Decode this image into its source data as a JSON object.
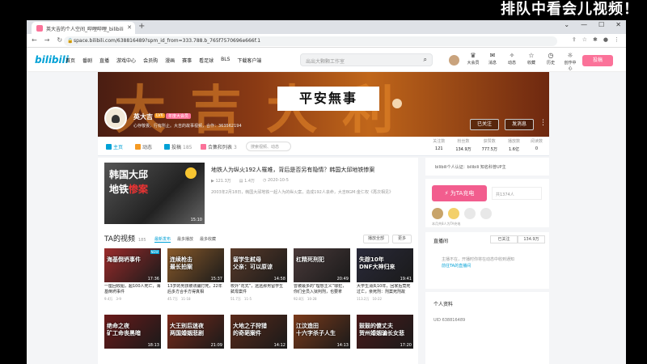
{
  "overlay_text": "排队中看会儿视频！",
  "browser": {
    "tab_title": "英大吉的个人空间_哔哩哔哩_bilibili",
    "url": "space.bilibili.com/638816489?spm_id_from=333.788.b_765f7570696e666f.1"
  },
  "topnav": {
    "logo": "bilibili",
    "links": [
      "首页",
      "番剧",
      "直播",
      "游戏中心",
      "会员购",
      "漫画",
      "赛事",
      "看足球",
      "BLS",
      "下载客户端"
    ],
    "search_placeholder": "出出大颗颗工作室",
    "right_items": [
      "大会员",
      "消息",
      "动态",
      "收藏",
      "历史",
      "创作中心"
    ],
    "upload_label": "投稿"
  },
  "profile": {
    "banner_big_text": "大吉大利",
    "banner_slogan": "平安無事",
    "name": "英大吉",
    "level": "LV6",
    "vip": "年度大会员",
    "sign": "心存敬畏，行有所止。大吉的故事视频，合作：363562194",
    "followed_label": "已关注",
    "message_label": "发消息"
  },
  "subnav": {
    "items": [
      {
        "label": "主页",
        "count": ""
      },
      {
        "label": "动态",
        "count": ""
      },
      {
        "label": "投稿",
        "count": "185"
      },
      {
        "label": "合集和列表",
        "count": "3"
      }
    ],
    "search_placeholder": "搜索视频、动态",
    "stats": [
      {
        "label": "关注数",
        "value": "121"
      },
      {
        "label": "粉丝数",
        "value": "134.9万"
      },
      {
        "label": "获赞数",
        "value": "777.5万"
      },
      {
        "label": "播放数",
        "value": "1.6亿"
      },
      {
        "label": "阅读数",
        "value": "0"
      }
    ]
  },
  "featured": {
    "thumb_line1": "韩国大邱",
    "thumb_line2_a": "地铁",
    "thumb_line2_b": "惨案",
    "duration": "15:10",
    "title": "地铁人为纵火192人罹难，背后是否另有隐情？韩国大邱地铁惨案",
    "views": "121.3万",
    "danmaku": "1.4万",
    "date": "2020-10-5",
    "desc": "2003年2月18日，韩国大邱地铁一起人为的纵火案，造成192人丧命，大吉BGM:金仁权《再次相见》"
  },
  "videos_section": {
    "title": "TA的视频",
    "count": "185",
    "sort": [
      "最新发布",
      "最多播放",
      "最多收藏"
    ],
    "play_all": "播放全部",
    "more": "更多"
  },
  "videos": [
    {
      "cap1": "海基倒坍事件",
      "cap2": "",
      "dur": "17:36",
      "title": "一座回收船，超100人死亡，海基倒坍事件",
      "views": "9.4万",
      "date": "3-9",
      "color": "#9a2b2b",
      "badge": "NEW"
    },
    {
      "cap1": "连续枪击",
      "cap2": "最长拍案",
      "dur": "15:37",
      "title": "13岁的男孩被诱骗打死，22年后多方合手方得真相",
      "views": "45.7万",
      "date": "11-18",
      "color": "#8a5a2a",
      "badge": ""
    },
    {
      "cap1": "留学生弒母",
      "cap2": "父亲：可以原谅",
      "dur": "14:58",
      "title": "校外“花式”，远远那男留学生弑母案件",
      "views": "51.7万",
      "date": "11-5",
      "color": "#5a3b2a",
      "badge": ""
    },
    {
      "cap1": "杠精死刑犯",
      "cap2": "",
      "dur": "20:49",
      "title": "曾被最多的“理想主义”罪犯，你们全员入狱判刑，也要拿",
      "views": "92.8万",
      "date": "10-28",
      "color": "#4a3a3a",
      "badge": ""
    },
    {
      "cap1": "失踪10年",
      "cap2": "DNF大神归来",
      "dur": "19:41",
      "title": "大学生消失10年，回家后竟死过亡，亲死刑：刑案死刑故",
      "views": "113.2万",
      "date": "10-22",
      "color": "#2a2a3a",
      "badge": ""
    },
    {
      "cap1": "绝命之夜",
      "cap2": "矿工命丧黑暗",
      "dur": "18:13",
      "title": "",
      "views": "",
      "date": "",
      "color": "#6a1a1a",
      "badge": ""
    },
    {
      "cap1": "大王别后迷夜",
      "cap2": "两国婚姻悲剧",
      "dur": "21:09",
      "title": "",
      "views": "",
      "date": "",
      "color": "#7a2a1a",
      "badge": ""
    },
    {
      "cap1": "大地之子狩猎",
      "cap2": "的奇葩案件",
      "dur": "14:12",
      "title": "",
      "views": "",
      "date": "",
      "color": "#5a2a1a",
      "badge": ""
    },
    {
      "cap1": "江汶造田",
      "cap2": "十六字杀子人生",
      "dur": "14:13",
      "title": "",
      "views": "",
      "date": "",
      "color": "#7a3a1a",
      "badge": ""
    },
    {
      "cap1": "鼓鼓的傻丈夫",
      "cap2": "贺州婚姻骗长女悲",
      "dur": "17:20",
      "title": "",
      "views": "",
      "date": "",
      "color": "#4a1a1a",
      "badge": ""
    }
  ],
  "sidebar": {
    "notice": "bilibili个人认证：bilibili 知名科普UP主",
    "charge_label": "为TA充电",
    "charge_count": "共1374人",
    "charge_footer": "本月共8人为TA充电",
    "live_title": "直播间",
    "live_tabs": [
      "已关注",
      "134.9万"
    ],
    "live_body_1": "主播不在，开播时你将在动态中收到通知",
    "live_link": "前往TA的直播间",
    "info_title": "个人资料",
    "uid": "UID  638816489"
  }
}
